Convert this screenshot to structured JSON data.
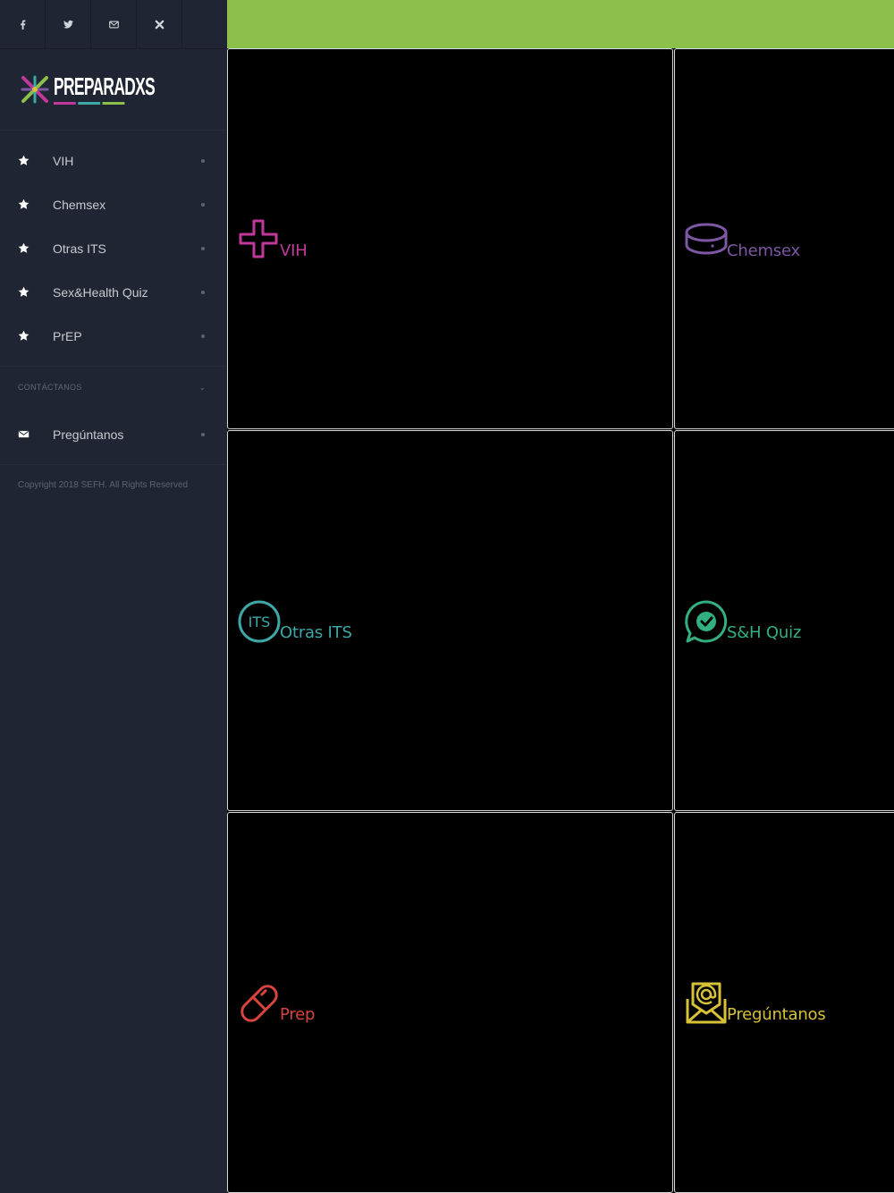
{
  "social": [
    {
      "icon": "facebook-icon"
    },
    {
      "icon": "twitter-icon"
    },
    {
      "icon": "envelope-icon"
    },
    {
      "icon": "close-icon"
    }
  ],
  "brand": {
    "name": "PREPARADXS"
  },
  "nav": [
    {
      "label": "VIH",
      "icon": "star-icon"
    },
    {
      "label": "Chemsex",
      "icon": "star-icon"
    },
    {
      "label": "Otras ITS",
      "icon": "star-icon"
    },
    {
      "label": "Sex&Health Quiz",
      "icon": "star-icon"
    },
    {
      "label": "PrEP",
      "icon": "star-icon"
    }
  ],
  "contact": {
    "heading": "CONTÁCTANOS",
    "items": [
      {
        "label": "Pregúntanos",
        "icon": "envelope-icon"
      }
    ]
  },
  "copyright": "Copyright 2018 SEFH. All Rights Reserved",
  "colors": {
    "topbar": "#8bc14a",
    "sidebar": "#1f2532",
    "vih": "#c0399a",
    "chemsex": "#7d57a4",
    "its": "#3ea7a7",
    "quiz": "#33b07f",
    "prep": "#d6443d",
    "preguntanos": "#d7c137"
  },
  "tiles": [
    {
      "label": "VIH",
      "icon": "plus-icon",
      "color": "#c0399a"
    },
    {
      "label": "Chemsex",
      "icon": "pill-disc-icon",
      "color": "#7d57a4"
    },
    {
      "label": "Otras ITS",
      "icon": "its-badge-icon",
      "color": "#3ea7a7"
    },
    {
      "label": "S&H Quiz",
      "icon": "check-chat-icon",
      "color": "#33b07f"
    },
    {
      "label": "Prep",
      "icon": "capsule-icon",
      "color": "#d6443d"
    },
    {
      "label": "Pregúntanos",
      "icon": "mail-at-icon",
      "color": "#d7c137"
    }
  ]
}
